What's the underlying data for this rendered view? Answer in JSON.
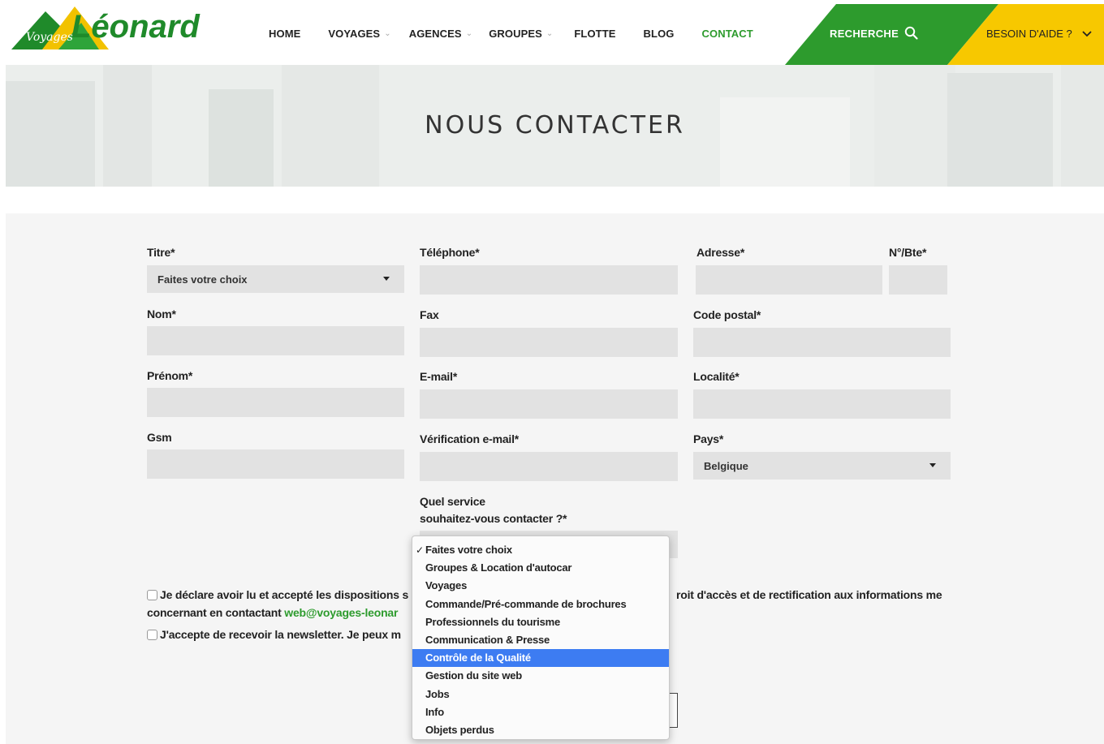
{
  "header": {
    "logo_script": "Voyages",
    "logo_name": "Léonard",
    "nav": [
      {
        "label": "HOME",
        "has_dropdown": false
      },
      {
        "label": "VOYAGES",
        "has_dropdown": true
      },
      {
        "label": "AGENCES",
        "has_dropdown": true
      },
      {
        "label": "GROUPES",
        "has_dropdown": true
      },
      {
        "label": "FLOTTE",
        "has_dropdown": false
      },
      {
        "label": "BLOG",
        "has_dropdown": false
      },
      {
        "label": "CONTACT",
        "has_dropdown": false,
        "active": true
      }
    ],
    "search_label": "RECHERCHE",
    "help_label": "BESOIN D'AIDE ?"
  },
  "hero": {
    "title": "NOUS CONTACTER"
  },
  "form": {
    "titre": {
      "label": "Titre*",
      "value": "Faites votre choix"
    },
    "nom": {
      "label": "Nom*",
      "value": ""
    },
    "prenom": {
      "label": "Prénom*",
      "value": ""
    },
    "gsm": {
      "label": "Gsm",
      "value": ""
    },
    "telephone": {
      "label": "Téléphone*",
      "value": ""
    },
    "fax": {
      "label": "Fax",
      "value": ""
    },
    "email": {
      "label": "E-mail*",
      "value": ""
    },
    "email_verif": {
      "label": "Vérification e-mail*",
      "value": ""
    },
    "service": {
      "label_line1": "Quel service",
      "label_line2": "souhaitez-vous contacter ?*"
    },
    "adresse": {
      "label": "Adresse*",
      "value": ""
    },
    "numero": {
      "label": "N°/Bte*",
      "value": ""
    },
    "code_postal": {
      "label": "Code postal*",
      "value": ""
    },
    "localite": {
      "label": "Localité*",
      "value": ""
    },
    "pays": {
      "label": "Pays*",
      "value": "Belgique"
    },
    "consent_text_before": "Je déclare avoir lu et accepté les dispositions s",
    "consent_text_after": "roit d'accès et de rectification aux informations me",
    "consent_line2_before": "concernant en contactant ",
    "consent_email": "web@voyages-leonar",
    "newsletter_text": "J'accepte de recevoir la newsletter. Je peux m"
  },
  "service_dropdown": {
    "options": [
      {
        "label": "Faites votre choix",
        "checked": true
      },
      {
        "label": "Groupes & Location d'autocar"
      },
      {
        "label": "Voyages"
      },
      {
        "label": "Commande/Pré-commande de brochures"
      },
      {
        "label": "Professionnels du tourisme"
      },
      {
        "label": "Communication & Presse"
      },
      {
        "label": "Contrôle de la Qualité",
        "highlighted": true
      },
      {
        "label": "Gestion du site web"
      },
      {
        "label": "Jobs"
      },
      {
        "label": "Info"
      },
      {
        "label": "Objets perdus"
      }
    ]
  },
  "colors": {
    "brand_green": "#2d9b2d",
    "brand_yellow": "#f7c800",
    "highlight_blue": "#3d7cf2"
  }
}
